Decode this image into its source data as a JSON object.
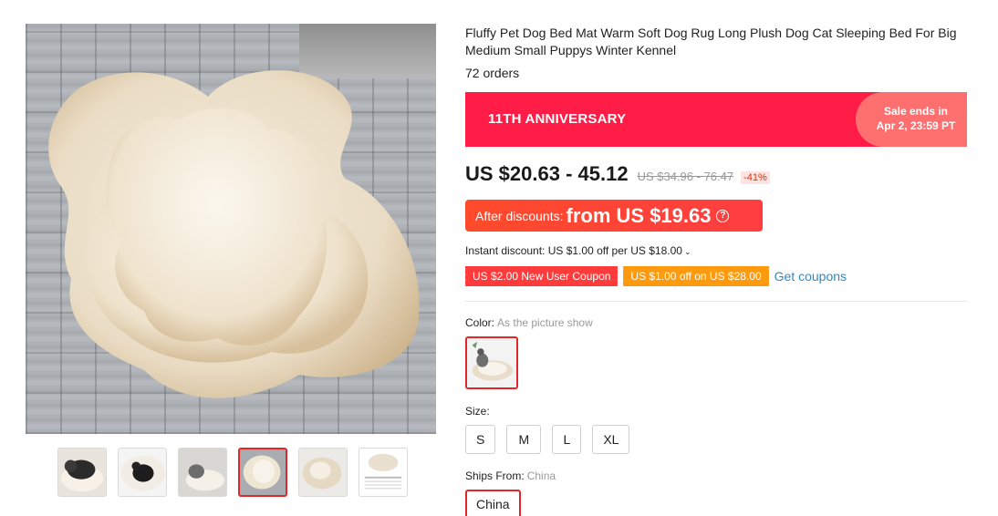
{
  "product": {
    "title": "Fluffy Pet Dog Bed Mat Warm Soft Dog Rug Long Plush Dog Cat Sleeping Bed For Big Medium Small Puppys Winter Kennel",
    "orders": "72 orders"
  },
  "banner": {
    "title": "11TH ANNIVERSARY",
    "sale_line1": "Sale ends in",
    "sale_line2": "Apr 2, 23:59 PT",
    "color": "#ff1c47"
  },
  "pricing": {
    "price": "US $20.63 - 45.12",
    "original_price": "US $34.96 - 76.47",
    "discount": "-41%",
    "after_label": "After discounts:",
    "after_amount": "from US $19.63",
    "help_icon": "question-circle-icon"
  },
  "instant_discount": {
    "text": "Instant discount: US $1.00 off per US $18.00",
    "chevron": "⌄"
  },
  "coupons": {
    "items": [
      {
        "label": "US $2.00 New User Coupon",
        "color": "#ff3b3b"
      },
      {
        "label": "US $1.00 off on US $28.00",
        "color": "#ff9a0e"
      }
    ],
    "get_label": "Get coupons"
  },
  "options": {
    "color_label": "Color:",
    "color_value": "As the picture show",
    "size_label": "Size:",
    "sizes": [
      "S",
      "M",
      "L",
      "XL"
    ],
    "ships_label": "Ships From:",
    "ships_value": "China",
    "ships_button": "China"
  },
  "gallery": {
    "thumbnail_count": 6,
    "active_index": 3
  },
  "accent_color": "#e0272a"
}
